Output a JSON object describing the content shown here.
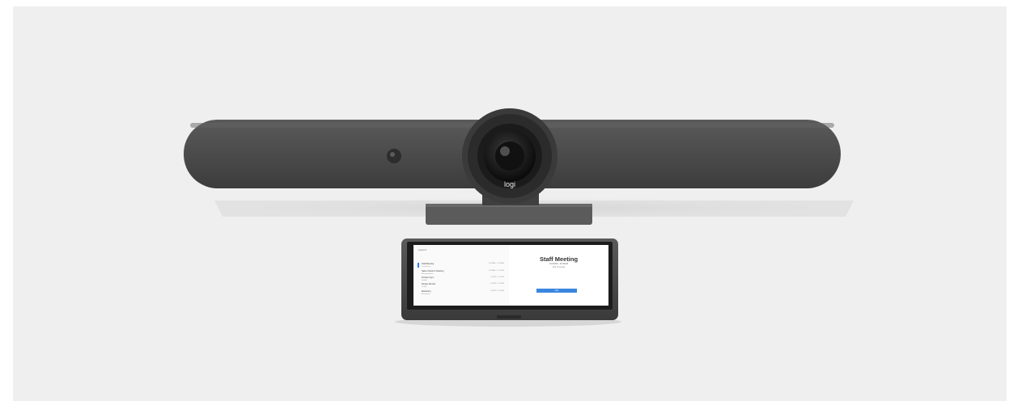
{
  "image": {
    "camera_badge": "logi"
  },
  "tablet": {
    "brand": "logitech",
    "meeting_title": "Staff Meeting",
    "meeting_time": "10:00AM - 11:00AM",
    "meeting_sub": "with 12 people",
    "join_label": "Join",
    "schedule": [
      {
        "title": "Staff Meeting",
        "sub": "Conference",
        "time": "10:00AM - 11:00AM"
      },
      {
        "title": "Sales Check-In Meeting",
        "sub": "Meeting Room",
        "time": "11:30AM - 12:30PM"
      },
      {
        "title": "Product Sync",
        "sub": "Huddle",
        "time": "1:00PM - 2:00PM"
      },
      {
        "title": "Design Review",
        "sub": "Studio",
        "time": "2:30PM - 3:30PM"
      },
      {
        "title": "Marketing",
        "sub": "Boardroom",
        "time": "4:00PM - 5:00PM"
      }
    ]
  },
  "colors": {
    "background": "#efefef",
    "bar_body": "#4a4a4a",
    "accent_blue": "#3a86e0"
  }
}
